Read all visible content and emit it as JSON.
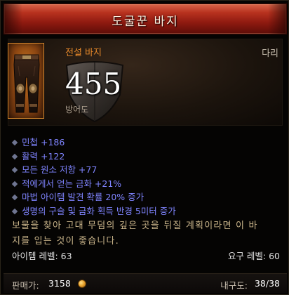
{
  "item": {
    "name": "도굴꾼 바지",
    "type_name": "전설 바지",
    "slot": "다리",
    "armor_value": "455",
    "armor_label": "방어도"
  },
  "stats": [
    "민첩 +186",
    "활력 +122",
    "모든 원소 저항 +77",
    "적에게서 얻는 금화 +21%",
    "마법 아이템 발견 확률 20% 증가",
    "생명의 구슬 및 금화 획득 반경 5미터 증가"
  ],
  "flavor_lines": [
    "보물을 찾아 고대 무덤의 깊은 곳을 뒤질 계획이라면 이 바",
    "지를 입는 것이 좋습니다."
  ],
  "levels": {
    "item_level": "아이템 레벨: 63",
    "required_level": "요구 레벨: 60"
  },
  "footer": {
    "price_label": "판매가:",
    "price_value": "3158",
    "durability_label": "내구도:",
    "durability_value": "38/38"
  },
  "colors": {
    "legendary_orange": "#e7892a",
    "magic_blue": "#7f84ff",
    "title_red": "#b8321f"
  },
  "icons": {
    "item_icon": "leather-pants-icon",
    "armor_icon": "shield-icon",
    "stat_bullet": "diamond-bullet-icon",
    "currency_icon": "gold-coin-icon"
  }
}
